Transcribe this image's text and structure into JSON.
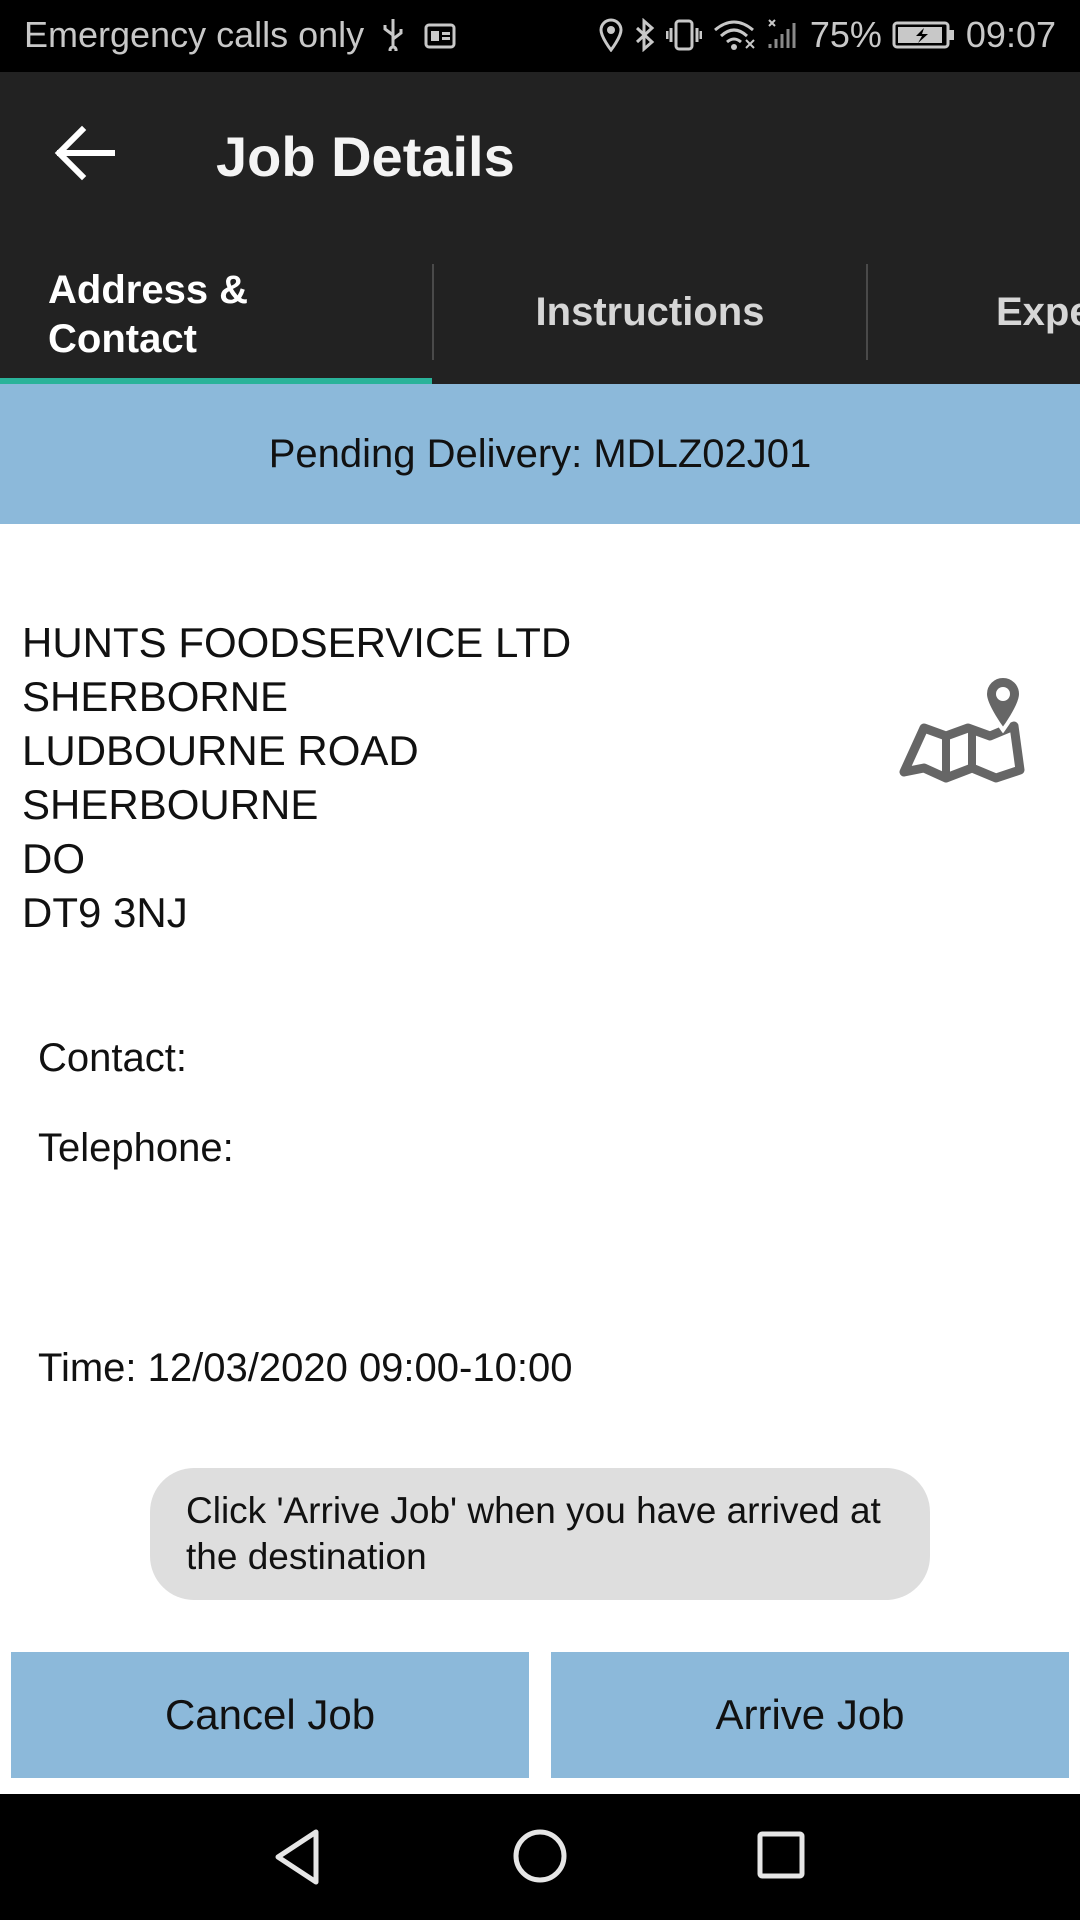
{
  "status_bar": {
    "carrier_text": "Emergency calls only",
    "battery": "75%",
    "time": "09:07",
    "icons": [
      "usb-icon",
      "sim-card-icon",
      "location-icon",
      "bluetooth-icon",
      "vibrate-icon",
      "wifi-icon",
      "signal-icon",
      "battery-charging-icon"
    ]
  },
  "app_bar": {
    "title": "Job Details",
    "back_icon": "arrow-left-icon"
  },
  "tabs": [
    {
      "label": "Address &\nContact",
      "selected": true
    },
    {
      "label": "Instructions",
      "selected": false
    },
    {
      "label": "Expe",
      "selected": false
    }
  ],
  "banner": {
    "text": "Pending Delivery: MDLZ02J01"
  },
  "address": {
    "lines": [
      "HUNTS FOODSERVICE LTD",
      "SHERBORNE",
      "LUDBOURNE ROAD",
      "SHERBOURNE",
      "DO",
      "DT9 3NJ"
    ],
    "map_icon": "map-pin-icon"
  },
  "details": {
    "contact_label": "Contact:",
    "telephone_label": "Telephone:",
    "time_label": "Time: 12/03/2020 09:00-10:00"
  },
  "hint": {
    "text": "Click 'Arrive Job' when you have arrived at the destination"
  },
  "actions": {
    "cancel_label": "Cancel Job",
    "arrive_label": "Arrive Job"
  },
  "nav_bar": {
    "icons": [
      "back-triangle-icon",
      "home-circle-icon",
      "recents-square-icon"
    ]
  },
  "colors": {
    "app_bar": "#222222",
    "accent_indicator": "#2ab39a",
    "banner": "#8cb9da",
    "button": "#8cb9da",
    "hint_bg": "#dedede"
  }
}
